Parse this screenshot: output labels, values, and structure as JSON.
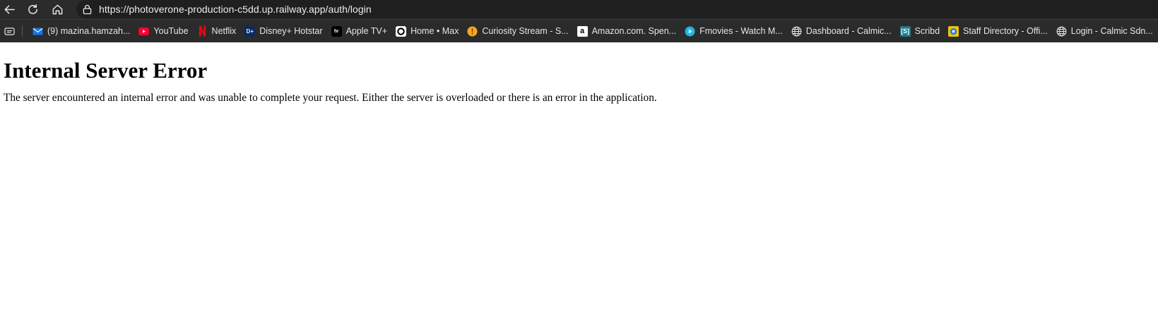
{
  "browser": {
    "url": "https://photoverone-production-c5dd.up.railway.app/auth/login",
    "bookmarks": [
      {
        "label": "(9) mazina.hamzah...",
        "icon": "mail-icon"
      },
      {
        "label": "YouTube",
        "icon": "youtube-icon"
      },
      {
        "label": "Netflix",
        "icon": "netflix-icon"
      },
      {
        "label": "Disney+ Hotstar",
        "icon": "disney-hotstar-icon"
      },
      {
        "label": "Apple TV+",
        "icon": "apple-tv-icon"
      },
      {
        "label": "Home • Max",
        "icon": "max-icon"
      },
      {
        "label": "Curiosity Stream - S...",
        "icon": "curiosity-stream-icon"
      },
      {
        "label": "Amazon.com. Spen...",
        "icon": "amazon-icon"
      },
      {
        "label": "Fmovies - Watch M...",
        "icon": "fmovies-icon"
      },
      {
        "label": "Dashboard - Calmic...",
        "icon": "globe-icon"
      },
      {
        "label": "Scribd",
        "icon": "scribd-icon"
      },
      {
        "label": "Staff Directory - Offi...",
        "icon": "staff-directory-icon"
      },
      {
        "label": "Login - Calmic Sdn...",
        "icon": "globe-icon"
      }
    ]
  },
  "page": {
    "title": "Internal Server Error",
    "message": "The server encountered an internal error and was unable to complete your request. Either the server is overloaded or there is an error in the application."
  }
}
